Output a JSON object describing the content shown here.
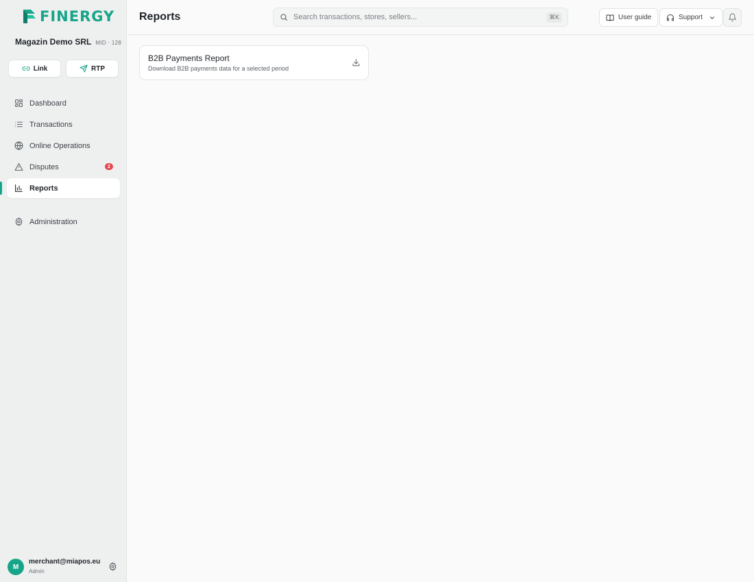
{
  "brand": {
    "name": "FINERGY",
    "color": "#17a589"
  },
  "merchant": {
    "name": "Magazin Demo SRL",
    "mid": "MID · 128"
  },
  "quick_actions": [
    {
      "label": "Link",
      "icon": "link-icon"
    },
    {
      "label": "RTP",
      "icon": "send-icon"
    }
  ],
  "nav": {
    "items": [
      {
        "label": "Dashboard",
        "icon": "grid-icon"
      },
      {
        "label": "Transactions",
        "icon": "list-icon"
      },
      {
        "label": "Online Operations",
        "icon": "globe-icon"
      },
      {
        "label": "Disputes",
        "icon": "alert-triangle-icon",
        "badge": "2"
      },
      {
        "label": "Reports",
        "icon": "bar-chart-icon",
        "active": true
      }
    ],
    "admin": {
      "label": "Administration",
      "icon": "gear-icon"
    }
  },
  "user": {
    "initial": "M",
    "email": "merchant@miapos.eu",
    "role": "Admin"
  },
  "header": {
    "title": "Reports",
    "search_placeholder": "Search transactions, stores, sellers...",
    "search_value": "",
    "shortcut": "⌘K",
    "user_guide_label": "User guide",
    "support_label": "Support"
  },
  "reports": [
    {
      "title": "B2B Payments Report",
      "description": "Download B2B payments data for a selected period"
    }
  ],
  "colors": {
    "accent": "#17a589",
    "badge": "#e5484d",
    "sidebar_bg": "#eef0f0",
    "page_bg": "#fafafa"
  }
}
